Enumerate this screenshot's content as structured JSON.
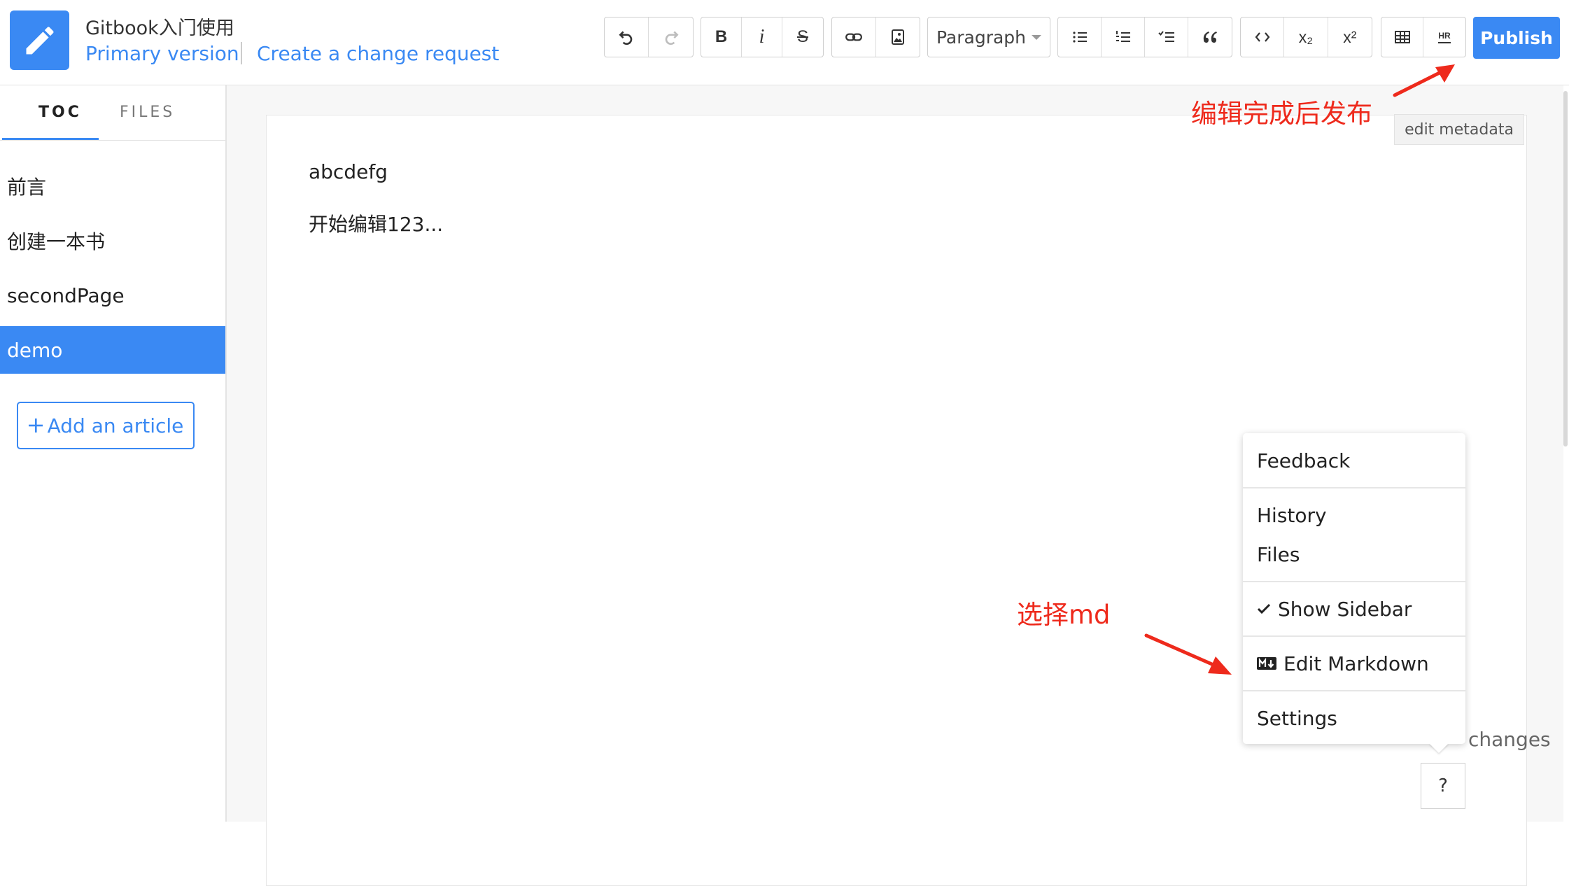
{
  "header": {
    "book_title": "Gitbook入门使用",
    "primary_version": "Primary version",
    "create_change_request": "Create a change request"
  },
  "toolbar": {
    "paragraph_label": "Paragraph",
    "publish_label": "Publish",
    "buttons": {
      "undo": "undo-icon",
      "redo": "redo-icon",
      "bold": "B",
      "italic": "i",
      "strike": "S",
      "link": "link-icon",
      "image": "image-icon",
      "bullet_list": "bullet-list-icon",
      "numbered_list": "numbered-list-icon",
      "task_list": "task-list-icon",
      "quote": "quote-icon",
      "code": "code-icon",
      "subscript": "x₂",
      "superscript": "x²",
      "table": "table-icon",
      "hr": "HR"
    }
  },
  "sidebar": {
    "tabs": [
      {
        "label": "TOC",
        "active": true
      },
      {
        "label": "FILES",
        "active": false
      }
    ],
    "items": [
      {
        "label": "前言",
        "active": false
      },
      {
        "label": "创建一本书",
        "active": false
      },
      {
        "label": "secondPage",
        "active": false
      },
      {
        "label": "demo",
        "active": true
      }
    ],
    "add_article": "Add an article"
  },
  "editor": {
    "paragraphs": [
      "abcdefg",
      "开始编辑123..."
    ],
    "edit_metadata": "edit metadata"
  },
  "help_menu": {
    "items": [
      {
        "label": "Feedback"
      },
      {
        "label": "History"
      },
      {
        "label": "Files"
      },
      {
        "label": "Show Sidebar",
        "checked": true
      },
      {
        "label": "Edit Markdown",
        "icon": "markdown-icon"
      },
      {
        "label": "Settings"
      }
    ],
    "help_button": "?",
    "changes_text": "changes"
  },
  "annotations": {
    "publish_note": "编辑完成后发布",
    "markdown_note": "选择md"
  },
  "colors": {
    "accent": "#3a89f3",
    "annotation": "#ee2a1c"
  }
}
